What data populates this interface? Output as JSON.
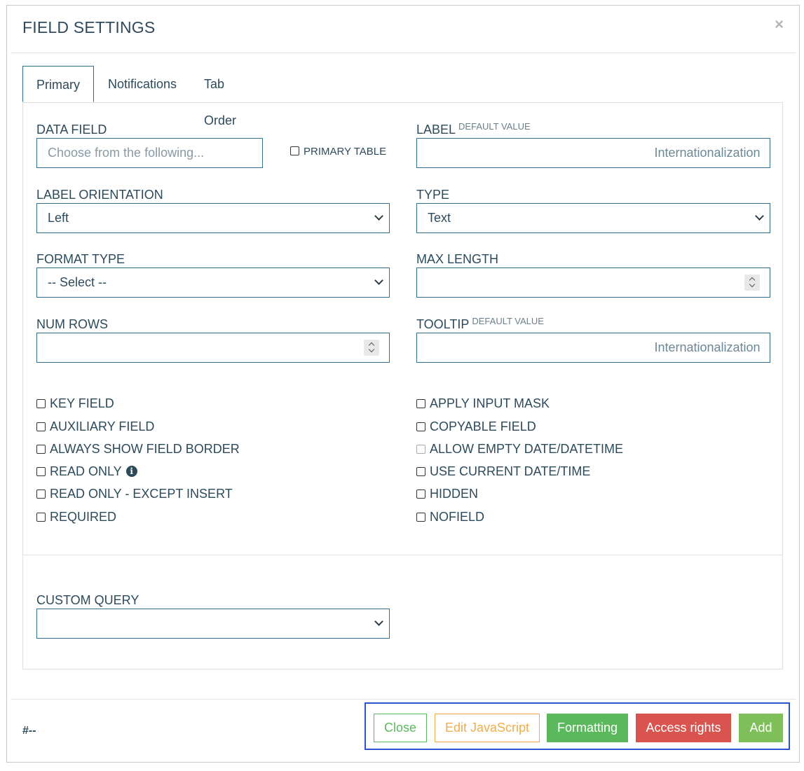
{
  "dialog": {
    "title": "FIELD SETTINGS",
    "close_icon": "×"
  },
  "tabs": [
    {
      "label": "Primary",
      "active": true
    },
    {
      "label": "Notifications",
      "active": false
    },
    {
      "label": "Tab Order",
      "active": false
    }
  ],
  "form": {
    "data_field": {
      "label": "DATA FIELD",
      "placeholder": "Choose from the following...",
      "value": ""
    },
    "primary_table": {
      "label": "PRIMARY TABLE",
      "checked": false
    },
    "label_field": {
      "label": "LABEL",
      "sup": "DEFAULT VALUE",
      "value": "",
      "addon": "Internationalization"
    },
    "label_orientation": {
      "label": "LABEL ORIENTATION",
      "value": "Left"
    },
    "type": {
      "label": "TYPE",
      "value": "Text"
    },
    "format_type": {
      "label": "FORMAT TYPE",
      "value": "-- Select --"
    },
    "max_length": {
      "label": "MAX LENGTH",
      "value": ""
    },
    "num_rows": {
      "label": "NUM ROWS",
      "value": ""
    },
    "tooltip": {
      "label": "TOOLTIP",
      "sup": "DEFAULT VALUE",
      "value": "",
      "addon": "Internationalization"
    },
    "checkboxes_left": [
      {
        "label": "KEY FIELD",
        "checked": false
      },
      {
        "label": "AUXILIARY FIELD",
        "checked": false
      },
      {
        "label": "ALWAYS SHOW FIELD BORDER",
        "checked": false
      },
      {
        "label": "READ ONLY",
        "checked": false
      },
      {
        "label": "READ ONLY - EXCEPT INSERT",
        "checked": false
      },
      {
        "label": "REQUIRED",
        "checked": false
      }
    ],
    "checkboxes_right": [
      {
        "label": "APPLY INPUT MASK",
        "checked": false
      },
      {
        "label": "COPYABLE FIELD",
        "checked": false
      },
      {
        "label": "ALLOW EMPTY DATE/DATETIME",
        "checked": false,
        "disabled": true
      },
      {
        "label": "USE CURRENT DATE/TIME",
        "checked": false
      },
      {
        "label": "HIDDEN",
        "checked": false
      },
      {
        "label": "NOFIELD",
        "checked": false
      }
    ],
    "custom_query": {
      "label": "CUSTOM QUERY",
      "value": ""
    }
  },
  "footer": {
    "hash_text": "#--",
    "buttons": {
      "close": "Close",
      "edit_js": "Edit JavaScript",
      "formatting": "Formatting",
      "access_rights": "Access rights",
      "add": "Add"
    }
  },
  "colors": {
    "primary_border": "#2f6f8f",
    "close_btn": "#5cb85c",
    "edit_js_btn": "#f0ad4e",
    "formatting_btn": "#5cb85c",
    "access_rights_btn": "#d9534f",
    "add_btn": "#7fbf5a",
    "highlight_group": "#2b55c8"
  },
  "icons": {
    "info": "info-icon",
    "close": "close-icon",
    "chevron": "chevron-down-icon",
    "spinner": "spinner-icon"
  }
}
